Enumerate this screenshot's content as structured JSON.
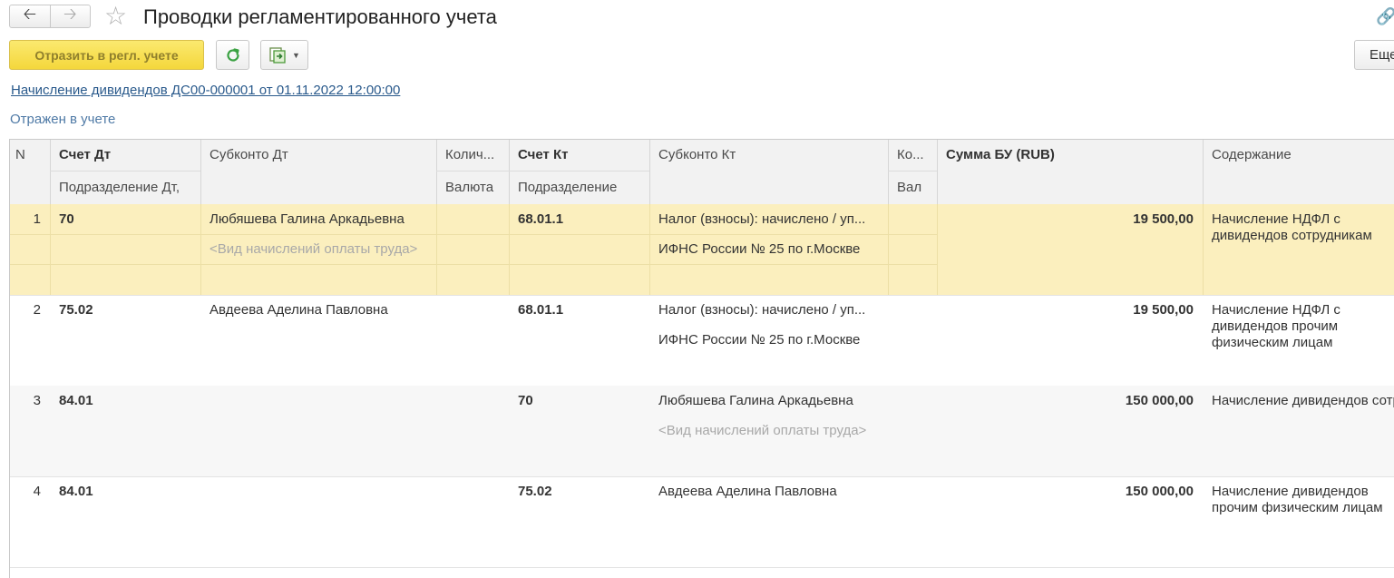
{
  "window": {
    "title": "Проводки регламентированного учета"
  },
  "toolbar": {
    "post_label": "Отразить в регл. учете",
    "more_label": "Еще"
  },
  "document_link": "Начисление дивидендов ДС00-000001 от 01.11.2022 12:00:00",
  "status": "Отражен в учете",
  "table": {
    "headers": {
      "n": "N",
      "debit_account": "Счет Дт",
      "debit_subdivision": "Подразделение Дт,",
      "debit_subconto": "Субконто Дт",
      "debit_qty": "Колич...",
      "debit_currency": "Валюта",
      "credit_account": "Счет Кт",
      "credit_subdivision": "Подразделение",
      "credit_subconto": "Субконто Кт",
      "credit_qty": "Ко...",
      "credit_currency": "Вал",
      "amount": "Сумма БУ (RUB)",
      "content": "Содержание"
    },
    "rows": [
      {
        "n": "1",
        "debit_account": "70",
        "debit_sub1": "Любяшева Галина Аркадьевна",
        "debit_sub2": "<Вид начислений оплаты труда>",
        "credit_account": "68.01.1",
        "credit_sub1": "Налог (взносы): начислено / уп...",
        "credit_sub2": "ИФНС России № 25 по г.Москве",
        "amount": "19 500,00",
        "content": "Начисление НДФЛ с дивидендов сотрудникам"
      },
      {
        "n": "2",
        "debit_account": "75.02",
        "debit_sub1": "Авдеева Аделина Павловна",
        "debit_sub2": "",
        "credit_account": "68.01.1",
        "credit_sub1": "Налог (взносы): начислено / уп...",
        "credit_sub2": "ИФНС России № 25 по г.Москве",
        "amount": "19 500,00",
        "content": "Начисление НДФЛ с дивидендов прочим физическим лицам"
      },
      {
        "n": "3",
        "debit_account": "84.01",
        "debit_sub1": "",
        "debit_sub2": "",
        "credit_account": "70",
        "credit_sub1": "Любяшева Галина Аркадьевна",
        "credit_sub2": "<Вид начислений оплаты труда>",
        "amount": "150 000,00",
        "content": "Начисление дивидендов сотрудникам"
      },
      {
        "n": "4",
        "debit_account": "84.01",
        "debit_sub1": "",
        "debit_sub2": "",
        "credit_account": "75.02",
        "credit_sub1": "Авдеева Аделина Павловна",
        "credit_sub2": "",
        "amount": "150 000,00",
        "content": "Начисление дивидендов прочим физическим лицам"
      }
    ]
  },
  "colors": {
    "primary_button": "#f4d73c",
    "selected_row": "#fbefbe",
    "link": "#2a5a8c",
    "refresh_icon": "#3aa142",
    "report_icon": "#4c9a3a"
  },
  "icons": [
    "back-arrow-icon",
    "forward-arrow-icon",
    "favorite-star-icon",
    "link-icon",
    "refresh-icon",
    "report-dtk-icon",
    "dropdown-caret-icon"
  ]
}
